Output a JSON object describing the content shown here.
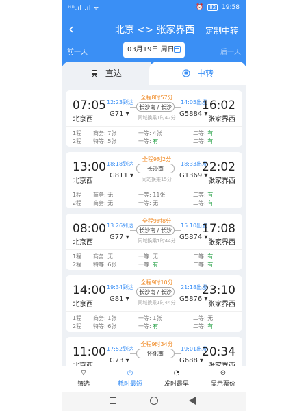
{
  "status": {
    "left": "ᴴᴰ.ıl .ıl ᯤ",
    "time": "19:58",
    "battery": "82"
  },
  "header": {
    "back": "‹",
    "title": "北京 <> 张家界西",
    "custom": "定制中转"
  },
  "dates": {
    "prev": "前一天",
    "current": "03月19日 周日",
    "next": "后一天"
  },
  "tabs": {
    "direct": "直达",
    "transfer": "中转"
  },
  "cards": [
    {
      "dep_time": "07:05",
      "dep_station": "北京西",
      "arr1": "12:23到达",
      "train1": "G71",
      "total": "全程8时57分",
      "via": "长沙南 / 长沙",
      "wait": "同城换乘1时42分",
      "dep2": "14:05出发",
      "train2": "G5884",
      "arr_time": "16:02",
      "arr_station": "张家界西",
      "r1": {
        "leg": "1程",
        "a": "商务: 7张",
        "b": "一等: 4张",
        "c": "二等: 有"
      },
      "r2": {
        "leg": "2程",
        "a": "特等: 5张",
        "b": "一等: 有",
        "c": "二等: 有"
      }
    },
    {
      "dep_time": "13:00",
      "dep_station": "北京西",
      "arr1": "18:18到达",
      "train1": "G811",
      "total": "全程9时2分",
      "via": "长沙南",
      "wait": "同站换乘15分",
      "dep2": "18:33出发",
      "train2": "G1369",
      "arr_time": "22:02",
      "arr_station": "张家界西",
      "r1": {
        "leg": "1程",
        "a": "商务: 无",
        "b": "一等: 11张",
        "c": "二等: 有"
      },
      "r2": {
        "leg": "2程",
        "a": "商务: 无",
        "b": "一等: 无",
        "c": "二等: 有"
      }
    },
    {
      "dep_time": "08:00",
      "dep_station": "北京西",
      "arr1": "13:26到达",
      "train1": "G77",
      "total": "全程9时8分",
      "via": "长沙南 / 长沙",
      "wait": "同城换乘1时44分",
      "dep2": "15:10出发",
      "train2": "G5874",
      "arr_time": "17:08",
      "arr_station": "张家界西",
      "r1": {
        "leg": "1程",
        "a": "商务: 无",
        "b": "一等: 无",
        "c": "二等: 有"
      },
      "r2": {
        "leg": "2程",
        "a": "特等: 6张",
        "b": "一等: 有",
        "c": "二等: 有"
      }
    },
    {
      "dep_time": "14:00",
      "dep_station": "北京西",
      "arr1": "19:34到达",
      "train1": "G81",
      "total": "全程9时10分",
      "via": "长沙南 / 长沙",
      "wait": "同城换乘1时44分",
      "dep2": "21:18出发",
      "train2": "G5876",
      "arr_time": "23:10",
      "arr_station": "张家界西",
      "r1": {
        "leg": "1程",
        "a": "商务: 1张",
        "b": "一等: 1张",
        "c": "二等: 无"
      },
      "r2": {
        "leg": "2程",
        "a": "特等: 6张",
        "b": "一等: 有",
        "c": "二等: 有"
      }
    },
    {
      "dep_time": "11:00",
      "dep_station": "北京西",
      "arr1": "17:52到达",
      "train1": "G73",
      "total": "全程9时34分",
      "via": "怀化南",
      "wait": "",
      "dep2": "19:01出发",
      "train2": "G688",
      "arr_time": "20:34",
      "arr_station": "张家界西",
      "r1": {
        "leg": "",
        "a": "",
        "b": "",
        "c": ""
      },
      "r2": {
        "leg": "",
        "a": "",
        "b": "",
        "c": ""
      }
    }
  ],
  "bottom": {
    "filter": "筛选",
    "shortest": "耗时最短",
    "earliest": "发时最早",
    "price": "显示票价"
  }
}
